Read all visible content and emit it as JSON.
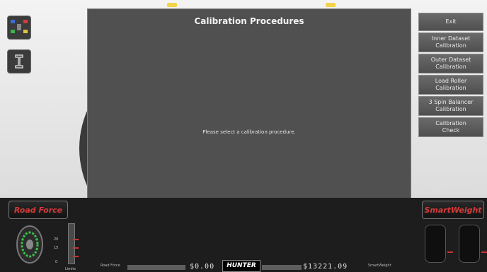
{
  "dialog": {
    "title": "Calibration Procedures",
    "message": "Please select a calibration procedure."
  },
  "right_menu": {
    "items": [
      {
        "label": "Exit"
      },
      {
        "label": "Inner Dataset\nCalibration"
      },
      {
        "label": "Outer Dataset\nCalibration"
      },
      {
        "label": "Load Roller\nCalibration"
      },
      {
        "label": "3 Spin Balancer\nCalibration"
      },
      {
        "label": "Calibration\nCheck"
      }
    ]
  },
  "bottom": {
    "road_force_logo": "Road Force",
    "smartweight_logo": "SmartWeight",
    "gauge_ticks": [
      "20",
      "15",
      "0"
    ],
    "limits_label": "Limits",
    "road_force_label": "Road Force",
    "road_force_value": "$0.00",
    "brand": "HUNTER",
    "smartweight_value": "$13221.09",
    "smartweight_label": "SmartWeight"
  },
  "colors": {
    "dialog_bg": "#505050",
    "accent_red": "#d63a3a",
    "button_bg": "#5c5c5c"
  }
}
